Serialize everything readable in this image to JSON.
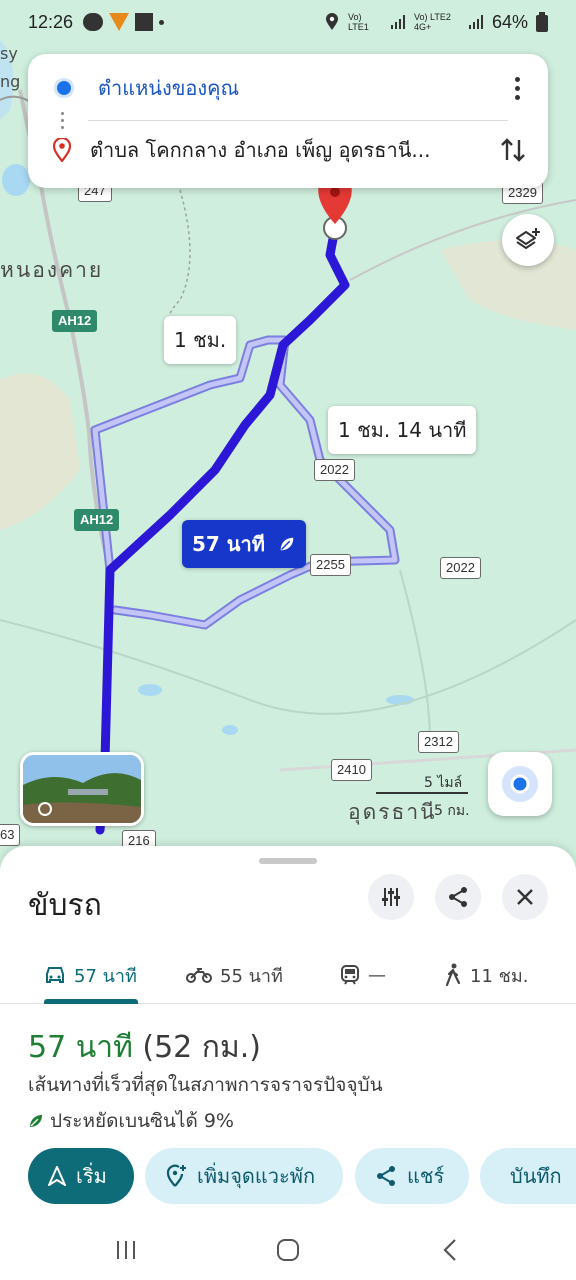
{
  "status_bar": {
    "time": "12:26",
    "sim1": "Vo) LTE1",
    "sim2": "Vo) LTE2 4G+",
    "battery": "64%"
  },
  "search": {
    "origin": "ตำแหน่งของคุณ",
    "destination": "ตำบล โคกกลาง อำเภอ เพ็ญ อุดรธานี..."
  },
  "map": {
    "labels": {
      "nong_khai": "หนองคาย",
      "udon": "อุดรธานี",
      "edge_top_left_1": "sy",
      "edge_top_left_2": "ng"
    },
    "shields": {
      "s247": "247",
      "s2329": "2329",
      "ah12_a": "AH12",
      "ah12_b": "AH12",
      "s2022_a": "2022",
      "s2255": "2255",
      "s2022_b": "2022",
      "s2312": "2312",
      "s2410": "2410",
      "s216": "216",
      "s63": "63"
    },
    "route_bubbles": {
      "alt1": "1 ชม.",
      "alt2": "1 ชม. 14 นาที",
      "primary": "57 นาที"
    },
    "scale": {
      "miles": "5 ไมล์",
      "km": "5 กม."
    }
  },
  "sheet": {
    "title": "ขับรถ",
    "modes": [
      {
        "label": "57 นาที",
        "icon": "car-icon"
      },
      {
        "label": "55 นาที",
        "icon": "motorcycle-icon"
      },
      {
        "label": "—",
        "icon": "train-icon"
      },
      {
        "label": "11 ชม.",
        "icon": "walk-icon"
      }
    ],
    "summary_time": "57 นาที",
    "summary_distance": "(52 กม.)",
    "description": "เส้นทางที่เร็วที่สุดในสภาพการจราจรปัจจุบัน",
    "eco": "ประหยัดเบนซินได้ 9%",
    "actions": {
      "start": "เริ่ม",
      "add_stop": "เพิ่มจุดแวะพัก",
      "share": "แชร์",
      "save": "บันทึก"
    }
  },
  "colors": {
    "route_primary": "#2d17d6",
    "route_alt": "#a6a8f0",
    "accent_teal": "#0e6c78",
    "time_green": "#1e7e34",
    "map_bg": "#cfeedd"
  }
}
